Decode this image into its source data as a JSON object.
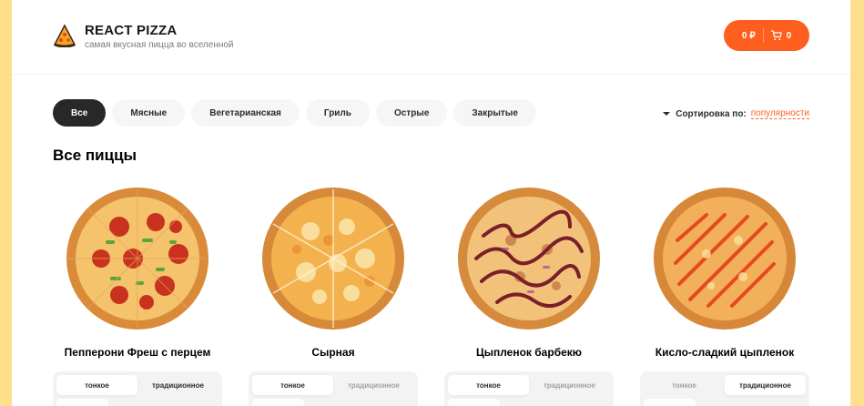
{
  "header": {
    "logo_icon": "pizza-slice-icon",
    "title": "REACT PIZZA",
    "subtitle": "самая вкусная пицца во вселенной",
    "cart": {
      "price": "0 ₽",
      "count": "0",
      "icon": "cart-icon"
    }
  },
  "categories": [
    "Все",
    "Мясные",
    "Вегетарианская",
    "Гриль",
    "Острые",
    "Закрытые"
  ],
  "active_category": "Все",
  "sort": {
    "label": "Сортировка по:",
    "value": "популярности"
  },
  "section_title": "Все пиццы",
  "pizzas": [
    {
      "name": "Пепперони Фреш с перцем",
      "types": [
        "тонкое",
        "традиционное"
      ],
      "selected_type": "тонкое",
      "disabled_types": []
    },
    {
      "name": "Сырная",
      "types": [
        "тонкое",
        "традиционное"
      ],
      "selected_type": "тонкое",
      "disabled_types": [
        "традиционное"
      ]
    },
    {
      "name": "Цыпленок барбекю",
      "types": [
        "тонкое",
        "традиционное"
      ],
      "selected_type": "тонкое",
      "disabled_types": [
        "традиционное"
      ]
    },
    {
      "name": "Кисло-сладкий цыпленок",
      "types": [
        "тонкое",
        "традиционное"
      ],
      "selected_type": "традиционное",
      "disabled_types": [
        "тонкое"
      ]
    }
  ],
  "colors": {
    "accent": "#fe5f1e",
    "background": "#ffdf8c",
    "active_category": "#282828"
  }
}
